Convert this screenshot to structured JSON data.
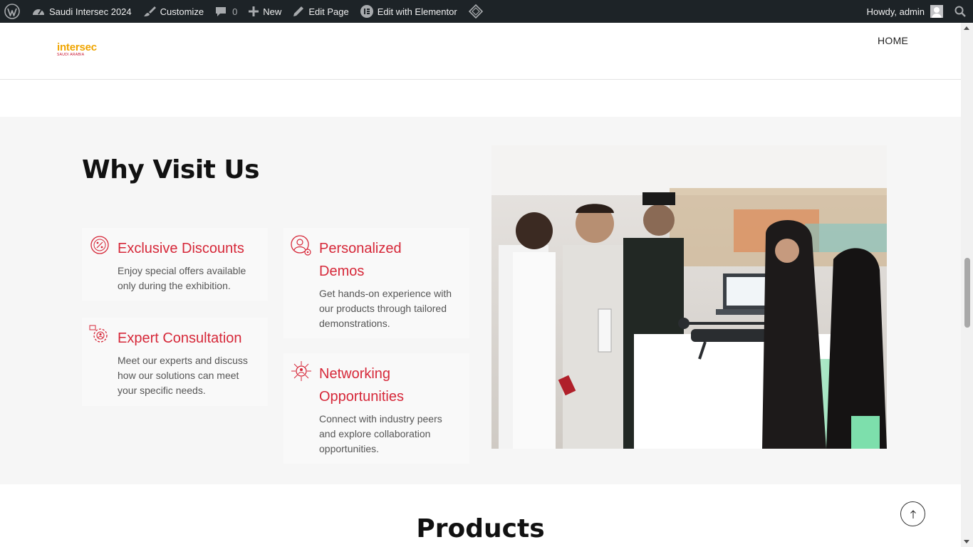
{
  "adminbar": {
    "site_name": "Saudi Intersec 2024",
    "customize": "Customize",
    "comments_count": "0",
    "new": "New",
    "edit_page": "Edit Page",
    "edit_elementor": "Edit with Elementor",
    "howdy": "Howdy, admin"
  },
  "header": {
    "logo_main": "intersec",
    "logo_sub": "SAUDI ARABIA",
    "nav_home": "HOME"
  },
  "why": {
    "title": "Why Visit Us",
    "cards": [
      {
        "title": "Exclusive Discounts",
        "text_lines": [
          "Enjoy special offers available",
          "only during the exhibition."
        ],
        "icon": "discount-icon"
      },
      {
        "title_lines": [
          "Personalized",
          "Demos"
        ],
        "text_lines": [
          "Get hands-on experience with",
          "our products through tailored",
          "demonstrations."
        ],
        "icon": "person-gear-icon"
      },
      {
        "title": "Expert Consultation",
        "text_lines": [
          "Meet our experts and discuss",
          "how our solutions can meet",
          "your specific needs."
        ],
        "icon": "consultation-icon"
      },
      {
        "title_lines": [
          "Networking",
          "Opportunities"
        ],
        "text_lines": [
          "Connect with industry peers",
          "and explore collaboration",
          "opportunities."
        ],
        "icon": "network-icon"
      }
    ]
  },
  "products": {
    "title": "Products"
  },
  "colors": {
    "accent": "#d62839",
    "logo_yellow": "#f0a500",
    "adminbar": "#1d2327"
  }
}
